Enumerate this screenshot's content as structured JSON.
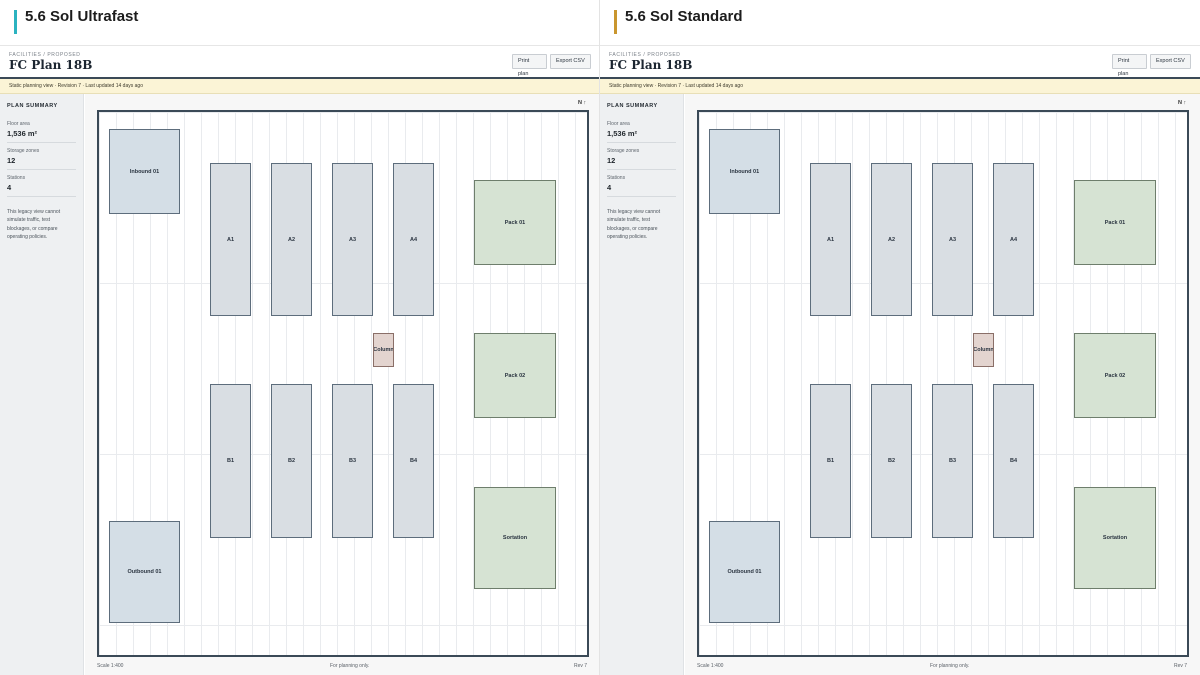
{
  "panels": [
    {
      "model_title": "5.6 Sol Ultrafast",
      "accent": "#2bb3c0",
      "breadcrumb": "FACILITIES / PROPOSED",
      "plan_title": "FC Plan 18B",
      "buttons": {
        "print": "Print plan",
        "export": "Export CSV"
      },
      "notice": "Static planning view · Revision 7 · Last updated 14 days ago",
      "sidebar": {
        "title": "PLAN SUMMARY",
        "floor_area_label": "Floor area",
        "floor_area_value": "1,536 m²",
        "storage_label": "Storage zones",
        "storage_value": "12",
        "stations_label": "Stations",
        "stations_value": "4",
        "note": "This legacy view cannot simulate traffic, test blockages, or compare operating policies."
      },
      "north": "N ↑",
      "zones": {
        "inbound": "Inbound 01",
        "outbound": "Outbound 01",
        "a1": "A1",
        "a2": "A2",
        "a3": "A3",
        "a4": "A4",
        "b1": "B1",
        "b2": "B2",
        "b3": "B3",
        "b4": "B4",
        "column": "Column",
        "pack1": "Pack 01",
        "pack2": "Pack 02",
        "sortation": "Sortation"
      },
      "footer": {
        "scale": "Scale 1:400",
        "note": "For planning only.",
        "rev": "Rev 7"
      }
    },
    {
      "model_title": "5.6 Sol Standard",
      "accent": "#c9962e",
      "breadcrumb": "FACILITIES / PROPOSED",
      "plan_title": "FC Plan 18B",
      "buttons": {
        "print": "Print plan",
        "export": "Export CSV"
      },
      "notice": "Static planning view · Revision 7 · Last updated 14 days ago",
      "sidebar": {
        "title": "PLAN SUMMARY",
        "floor_area_label": "Floor area",
        "floor_area_value": "1,536 m²",
        "storage_label": "Storage zones",
        "storage_value": "12",
        "stations_label": "Stations",
        "stations_value": "4",
        "note": "This legacy view cannot simulate traffic, test blockages, or compare operating policies."
      },
      "north": "N ↑",
      "zones": {
        "inbound": "Inbound 01",
        "outbound": "Outbound 01",
        "a1": "A1",
        "a2": "A2",
        "a3": "A3",
        "a4": "A4",
        "b1": "B1",
        "b2": "B2",
        "b3": "B3",
        "b4": "B4",
        "column": "Column",
        "pack1": "Pack 01",
        "pack2": "Pack 02",
        "sortation": "Sortation"
      },
      "footer": {
        "scale": "Scale 1:400",
        "note": "For planning only.",
        "rev": "Rev 7"
      }
    }
  ]
}
